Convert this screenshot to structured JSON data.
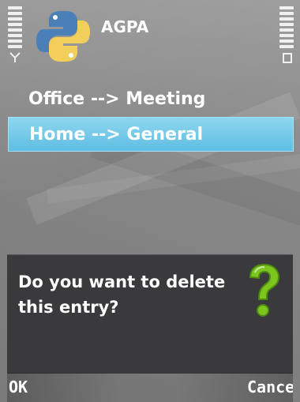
{
  "app": {
    "title": "AGPA",
    "logo_icon": "python-logo-icon"
  },
  "status": {
    "signal_icon": "signal-bars-icon",
    "battery_icon": "battery-bars-icon"
  },
  "list": {
    "items": [
      {
        "label": "Office --> Meeting",
        "selected": false
      },
      {
        "label": "Home --> General",
        "selected": true
      }
    ],
    "selected_color": "#6cc7e8"
  },
  "dialog": {
    "message": "Do you want to delete this entry?",
    "icon": "question-mark-icon",
    "icon_color": "#7cc61e"
  },
  "softkeys": {
    "left": "OK",
    "right": "Cancel"
  }
}
